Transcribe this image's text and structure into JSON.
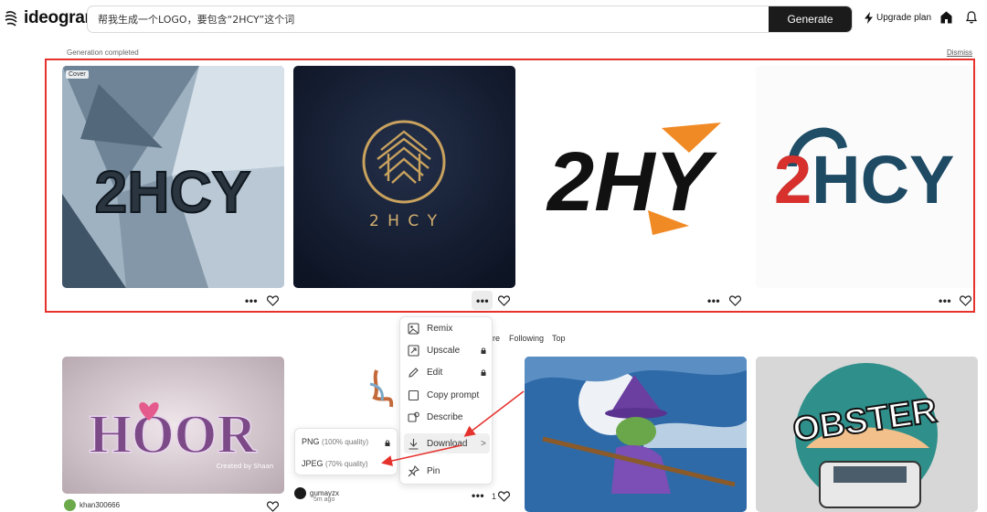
{
  "header": {
    "logo_text": "ideogram",
    "search": {
      "value": "帮我生成一个LOGO，要包含“2HCY”这个词",
      "placeholder": ""
    },
    "generate_label": "Generate",
    "upgrade_label": "Upgrade plan"
  },
  "generation": {
    "status": "Generation completed",
    "dismiss_label": "Dismiss",
    "cover_badge": "Cover",
    "images": [
      {
        "text": "2HCY"
      },
      {
        "text": "2 H C Y"
      },
      {
        "text": "2HY"
      },
      {
        "text": "2HCY"
      }
    ],
    "more_label": "•••"
  },
  "feed_tabs": [
    "re",
    "Following",
    "Top"
  ],
  "context_menu": {
    "items": [
      {
        "label": "Remix",
        "icon": "remix-icon",
        "locked": false
      },
      {
        "label": "Upscale",
        "icon": "upscale-icon",
        "locked": true
      },
      {
        "label": "Edit",
        "icon": "pencil-icon",
        "locked": true
      },
      {
        "label": "Copy prompt",
        "icon": "copy-icon",
        "locked": false
      },
      {
        "label": "Describe",
        "icon": "describe-icon",
        "locked": false
      },
      {
        "label": "Download",
        "icon": "download-icon",
        "locked": false,
        "has_submenu": true
      },
      {
        "label": "Pin",
        "icon": "pin-icon",
        "locked": false
      }
    ],
    "chevron": ">"
  },
  "download_submenu": {
    "items": [
      {
        "format": "PNG",
        "quality": "(100% quality)",
        "locked": true
      },
      {
        "format": "JPEG",
        "quality": "(70% quality)",
        "locked": false
      }
    ]
  },
  "feed": {
    "cards": [
      {
        "user": "khan300666",
        "text": "HOOR",
        "caption": "Created by Shaan"
      },
      {
        "user": "gumayzx",
        "time": "5m ago",
        "likes": "1"
      },
      {
        "user": ""
      },
      {
        "user": "",
        "text": "OBSTER"
      }
    ]
  },
  "colors": {
    "accent_red": "#e5322d",
    "button_dark": "#1b1b1b"
  }
}
